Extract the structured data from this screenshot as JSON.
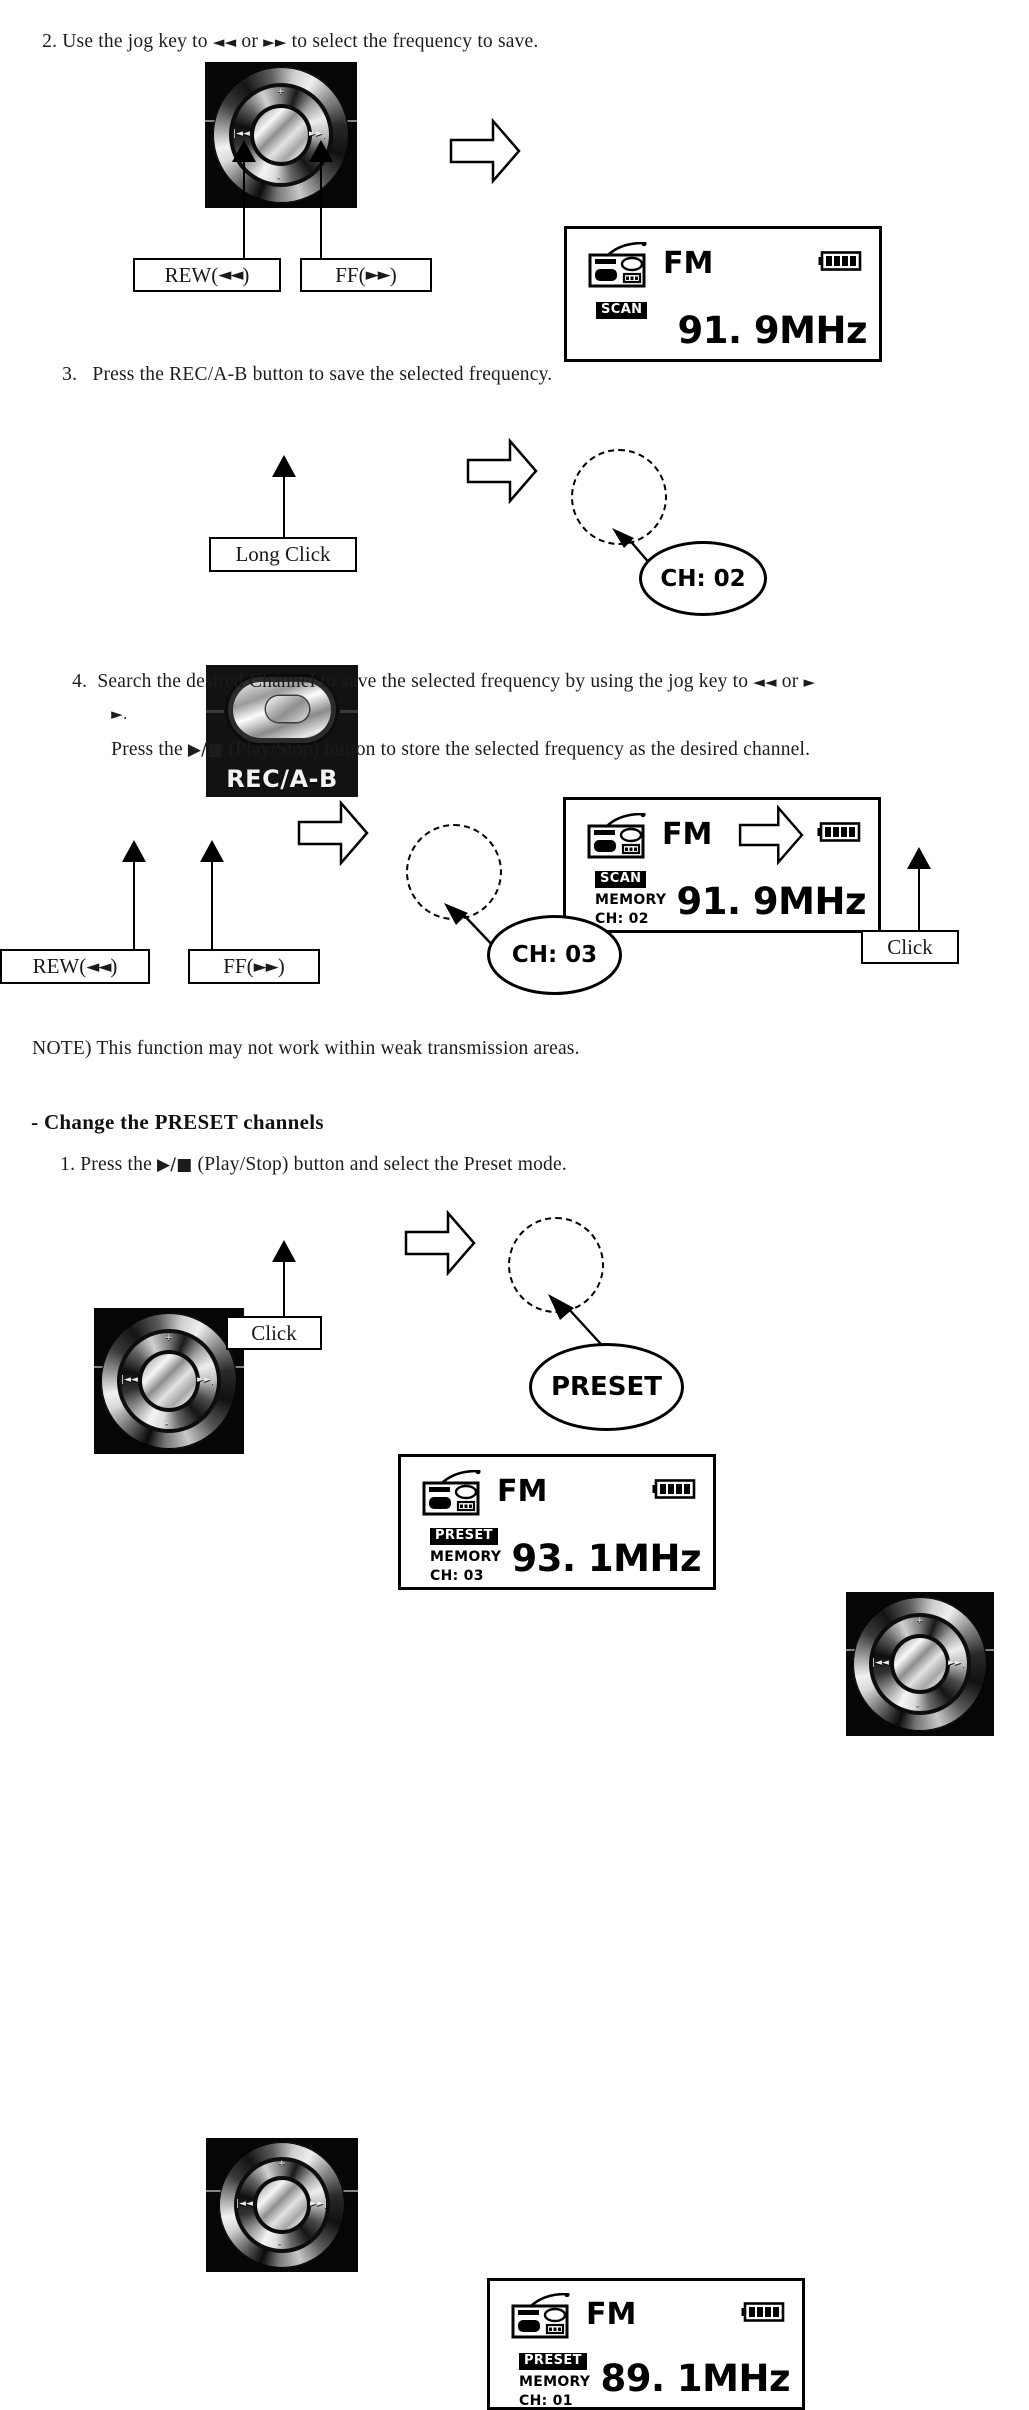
{
  "document": {
    "steps": [
      {
        "id": "step2",
        "number": "2.",
        "text_before": "Use the jog key to ",
        "icon_rew": "◄◄",
        "text_mid": " or ",
        "icon_ff": "►►",
        "text_after": " to select the frequency to save."
      },
      {
        "id": "step3",
        "number": "3.",
        "text": "Press the REC/A-B button to save the selected frequency."
      },
      {
        "id": "step4",
        "number": "4.",
        "line1_before": "Search the desired Channel to save the selected frequency by using the jog key to ",
        "icon_rew": "◄◄",
        "line1_mid": " or ",
        "icon_ff": "►",
        "line2": "►.",
        "line3_before": "Press the ",
        "line3_playstop": "▶/■",
        "line3_after": " (Play/Stop) button to store the selected frequency as the desired channel."
      }
    ],
    "note": "NOTE) This function may not work within weak transmission areas.",
    "section_heading": "- Change the PRESET channels",
    "section_step1": {
      "number": "1.",
      "text_before": "Press the ",
      "playstop": "▶/■",
      "text_after": " (Play/Stop) button and select the Preset mode."
    }
  },
  "callout_boxes": {
    "rew_1": {
      "prefix": "REW(",
      "arrows": "◄◄",
      "suffix": ")"
    },
    "ff_1": {
      "prefix": "FF(",
      "arrows": "►►",
      "suffix": ")"
    },
    "long_click": {
      "label": "Long Click"
    },
    "rew_2": {
      "prefix": "REW(",
      "arrows": "◄◄",
      "suffix": ")"
    },
    "ff_2": {
      "prefix": "FF(",
      "arrows": "►►",
      "suffix": ")"
    },
    "click_right": {
      "label": "Click"
    },
    "click_bottom": {
      "label": "Click"
    }
  },
  "oval_callouts": {
    "ch02": {
      "label": "CH: 02"
    },
    "ch03": {
      "label": "CH: 03"
    },
    "preset": {
      "label": "PRESET"
    }
  },
  "lcd_screens": [
    {
      "id": "lcd-1",
      "band_label": "FM",
      "frequency": "91. 9MHz",
      "tag": "SCAN",
      "memory_label": "",
      "channel_label": "",
      "battery_bars": 4,
      "highlighted": false
    },
    {
      "id": "lcd-2",
      "band_label": "FM",
      "frequency": "91. 9MHz",
      "tag": "SCAN",
      "memory_label": "MEMORY",
      "channel_label": "CH: 02",
      "battery_bars": 4,
      "highlighted": true
    },
    {
      "id": "lcd-3",
      "band_label": "FM",
      "frequency": "93. 1MHz",
      "tag": "PRESET",
      "memory_label": "MEMORY",
      "channel_label": "CH: 03",
      "battery_bars": 4,
      "highlighted": true
    },
    {
      "id": "lcd-4",
      "band_label": "FM",
      "frequency": "89. 1MHz",
      "tag": "PRESET",
      "memory_label": "MEMORY",
      "channel_label": "CH: 01",
      "battery_bars": 4,
      "highlighted": true
    }
  ],
  "devices": {
    "jog_dial": {
      "mark_plus": "+",
      "mark_minus": "-",
      "mark_prev": "|◄◄",
      "mark_next": "►►|"
    },
    "rec_button": {
      "label": "REC/A-B"
    }
  },
  "colors": {
    "ink": "#1a1a1a",
    "page": "#ffffff",
    "outline": "#000000"
  }
}
